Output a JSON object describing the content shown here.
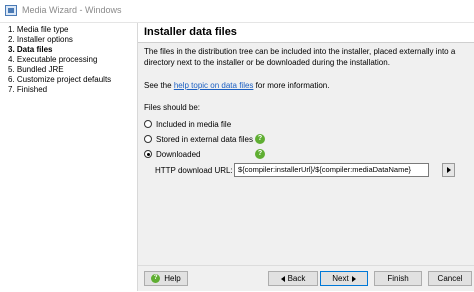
{
  "window": {
    "title": "Media Wizard - Windows"
  },
  "steps": [
    {
      "label": "1. Media file type"
    },
    {
      "label": "2. Installer options"
    },
    {
      "label": "3. Data files",
      "active": true
    },
    {
      "label": "4. Executable processing"
    },
    {
      "label": "5. Bundled JRE"
    },
    {
      "label": "6. Customize project defaults"
    },
    {
      "label": "7. Finished"
    }
  ],
  "header": {
    "title": "Installer data files"
  },
  "description": "The files in the distribution tree can be included into the installer, placed externally into a directory next to the installer or be downloaded during the installation.",
  "see_line": {
    "prefix": "See the ",
    "link": "help topic on data files",
    "suffix": " for more information."
  },
  "files_label": "Files should be:",
  "options": [
    {
      "label": "Included in media file",
      "checked": false
    },
    {
      "label": "Stored in external data files",
      "checked": false
    },
    {
      "label": "Downloaded",
      "checked": true
    }
  ],
  "url": {
    "label": "HTTP download URL:",
    "value": "${compiler:installerUrl}/${compiler:mediaDataName}"
  },
  "help_glyph": "?",
  "buttons": {
    "help": "Help",
    "back": "Back",
    "next": "Next",
    "finish": "Finish",
    "cancel": "Cancel"
  },
  "colors": {
    "help_icon": "#5fae32",
    "link": "#1b5fc2",
    "primary_border": "#0078d7"
  }
}
